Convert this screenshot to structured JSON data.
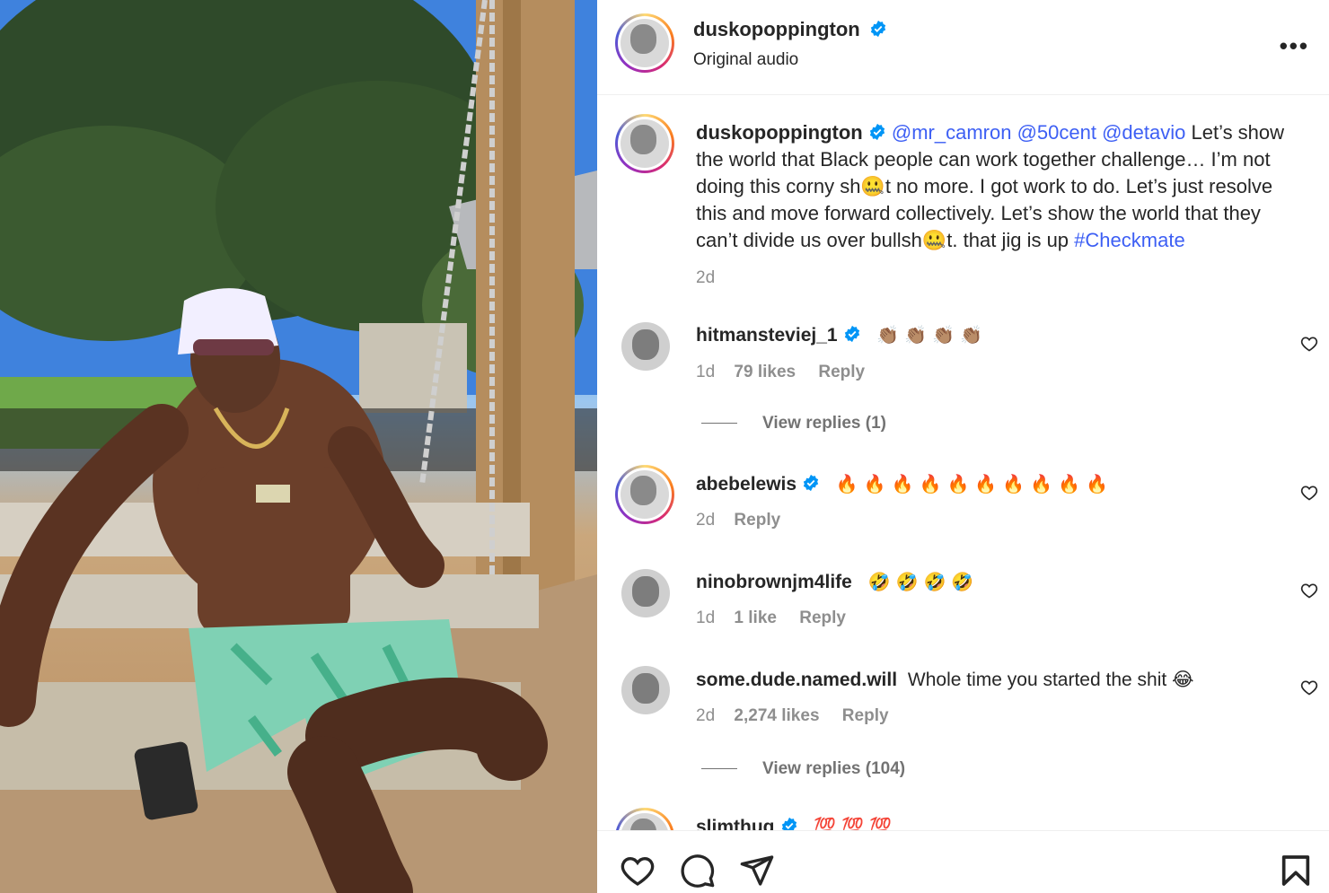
{
  "post": {
    "username": "duskopoppington",
    "audio": "Original audio",
    "more_label": "•••",
    "caption": {
      "username": "duskopoppington",
      "mentions": [
        "@mr_camron",
        "@50cent",
        "@detavio"
      ],
      "text_part1": "Let’s show the world that Black people can work together challenge… I’m not doing this corny sh🤐t no more. I got work to do. Let’s just resolve this and move forward collectively. Let’s show the world that they can’t divide us over bullsh🤐t. that jig is up",
      "hashtag": "#Checkmate",
      "time": "2d"
    }
  },
  "comments": [
    {
      "username": "hitmansteviej_1",
      "verified": true,
      "text": "👏🏽👏🏽👏🏽👏🏽",
      "time": "1d",
      "likes": "79 likes",
      "reply": "Reply",
      "view_replies": "View replies (1)"
    },
    {
      "username": "abebelewis",
      "verified": true,
      "text": "🔥🔥🔥🔥🔥🔥🔥🔥🔥🔥",
      "time": "2d",
      "likes": "",
      "reply": "Reply"
    },
    {
      "username": "ninobrownjm4life",
      "verified": false,
      "text": "🤣🤣🤣🤣",
      "time": "1d",
      "likes": "1 like",
      "reply": "Reply"
    },
    {
      "username": "some.dude.named.will",
      "verified": false,
      "text": "Whole time you started the shit 😂",
      "time": "2d",
      "likes": "2,274 likes",
      "reply": "Reply",
      "view_replies": "View replies (104)"
    },
    {
      "username": "slimthug",
      "verified": true,
      "text": "💯💯💯",
      "time": "",
      "likes": "",
      "reply": ""
    }
  ],
  "icons": {
    "like": "heart-icon",
    "comment": "comment-bubble-icon",
    "share": "paper-plane-icon",
    "save": "bookmark-icon",
    "verified": "verified-badge-icon"
  },
  "colors": {
    "accent": "#3d5ff4",
    "verified": "#0095f6",
    "muted": "#8e8e8e"
  }
}
